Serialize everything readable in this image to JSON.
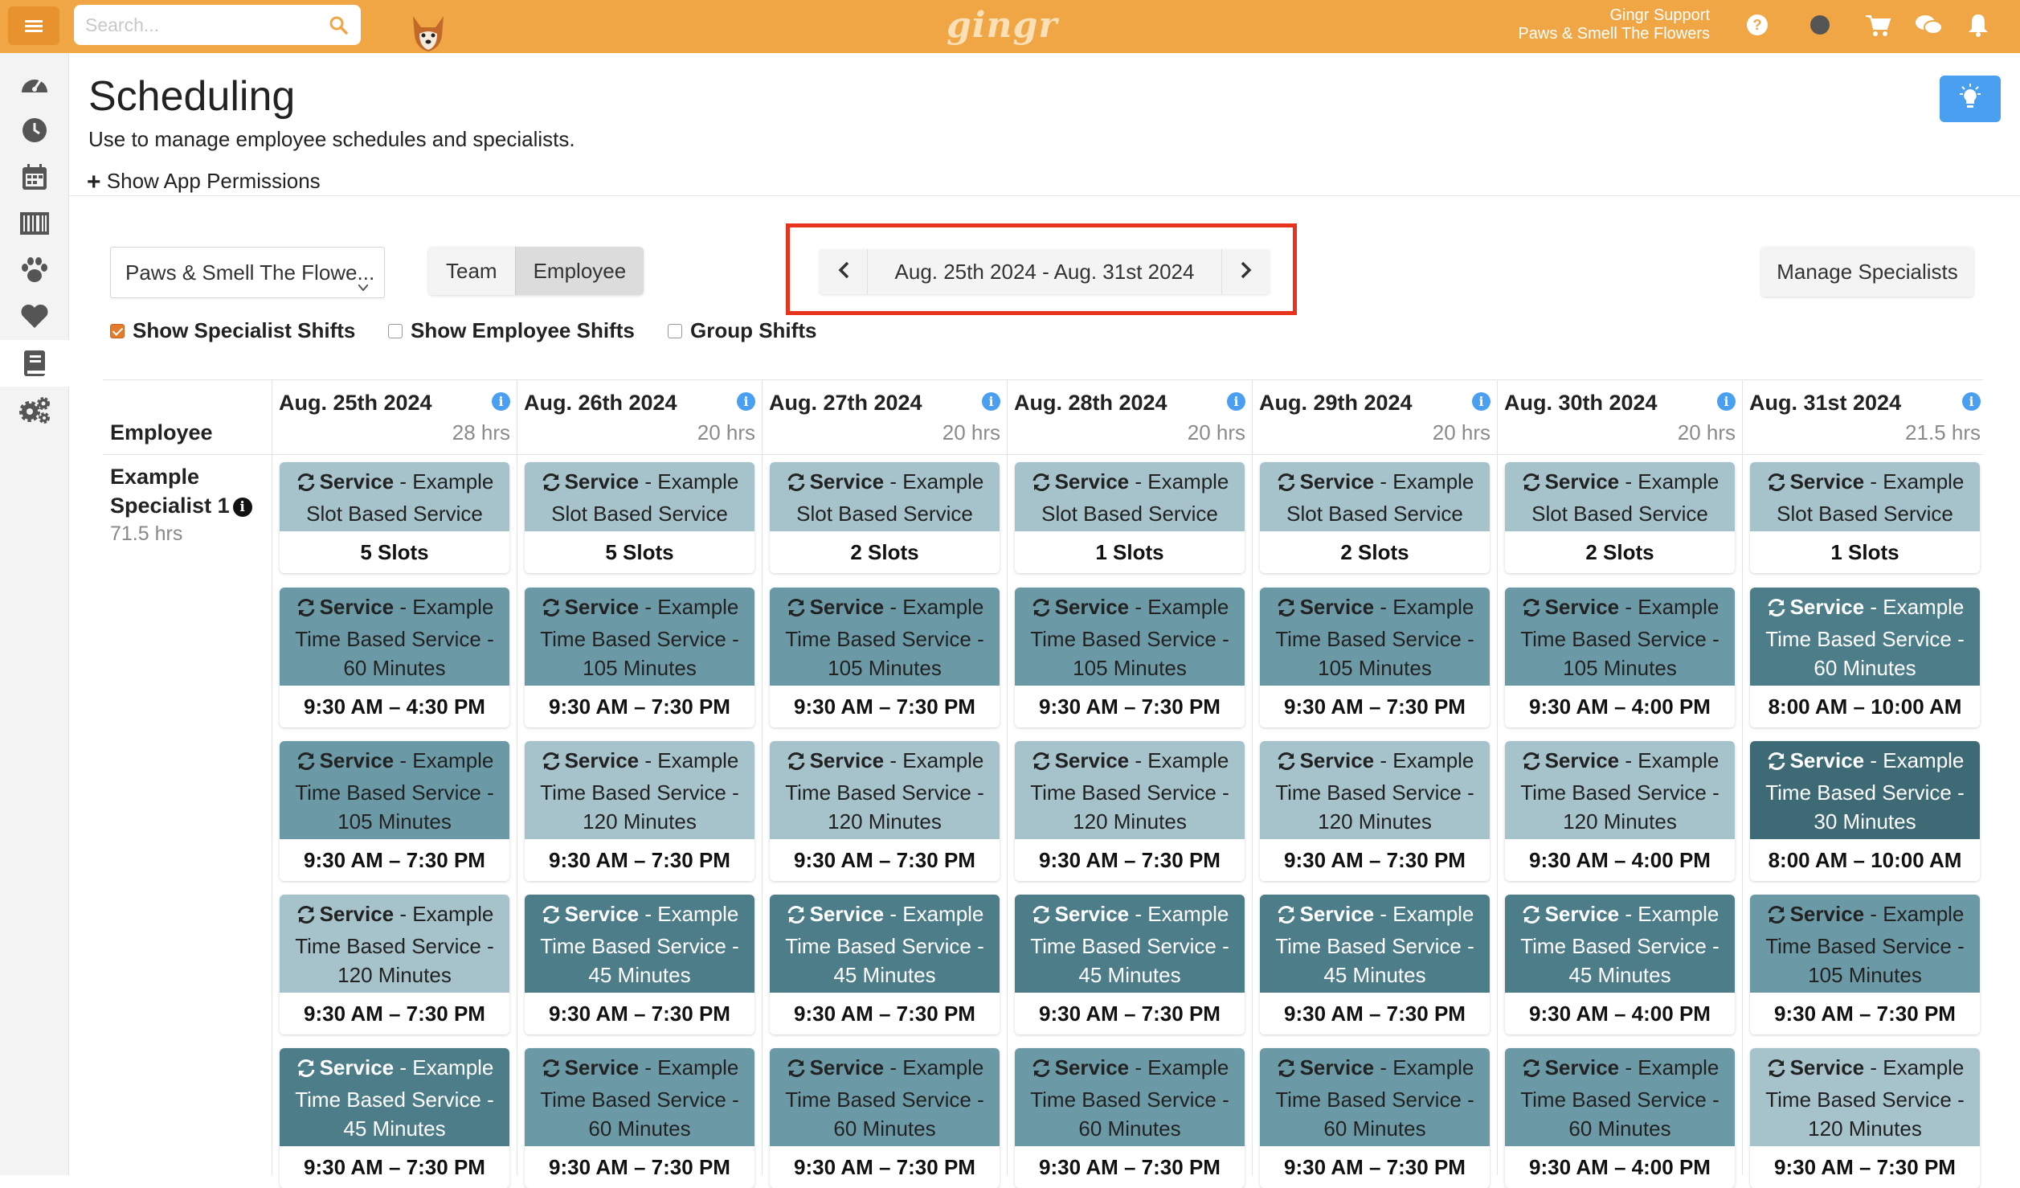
{
  "topbar": {
    "search_placeholder": "Search...",
    "logo": "gingr",
    "user_name": "Gingr Support",
    "user_location": "Paws & Smell The Flowers",
    "icons": [
      "menu-icon",
      "search-icon",
      "dog-avatar-icon",
      "help-icon",
      "status-dot-icon",
      "cart-icon",
      "chat-icon",
      "bell-icon"
    ]
  },
  "sidebar": {
    "items": [
      {
        "name": "dashboard-icon"
      },
      {
        "name": "clock-icon"
      },
      {
        "name": "calendar-icon"
      },
      {
        "name": "barcode-icon"
      },
      {
        "name": "paw-icon"
      },
      {
        "name": "heart-icon"
      },
      {
        "name": "book-icon",
        "active": true
      },
      {
        "name": "settings-icon"
      }
    ]
  },
  "page": {
    "title": "Scheduling",
    "subtitle": "Use to manage employee schedules and specialists.",
    "permissions_link": "Show App Permissions"
  },
  "controls": {
    "location": "Paws & Smell The Flowe...",
    "toggle": [
      "Team",
      "Employee"
    ],
    "toggle_selected": "Employee",
    "date_range": "Aug. 25th 2024 - Aug. 31st 2024",
    "manage_button": "Manage Specialists",
    "checkboxes": [
      {
        "label": "Show Specialist Shifts",
        "checked": true
      },
      {
        "label": "Show Employee Shifts",
        "checked": false
      },
      {
        "label": "Group Shifts",
        "checked": false
      }
    ]
  },
  "colors": {
    "accent": "#f0a644",
    "highlight_box": "#e8331f",
    "info": "#4a9ff0"
  },
  "grid": {
    "employee_header": "Employee",
    "employee": {
      "name": "Example Specialist 1",
      "hours": "71.5 hrs"
    },
    "days": [
      {
        "date": "Aug. 25th 2024",
        "hours": "28 hrs"
      },
      {
        "date": "Aug. 26th 2024",
        "hours": "20 hrs"
      },
      {
        "date": "Aug. 27th 2024",
        "hours": "20 hrs"
      },
      {
        "date": "Aug. 28th 2024",
        "hours": "20 hrs"
      },
      {
        "date": "Aug. 29th 2024",
        "hours": "20 hrs"
      },
      {
        "date": "Aug. 30th 2024",
        "hours": "20 hrs"
      },
      {
        "date": "Aug. 31st 2024",
        "hours": "21.5 hrs"
      }
    ],
    "service_word": "Service",
    "cards": [
      [
        {
          "desc": "Slot Based Service",
          "detail": "5 Slots",
          "shade": "c1"
        },
        {
          "desc": "Time Based Service - 60 Minutes",
          "detail": "9:30 AM – 4:30 PM",
          "shade": "c2"
        },
        {
          "desc": "Time Based Service - 105 Minutes",
          "detail": "9:30 AM – 7:30 PM",
          "shade": "c2"
        },
        {
          "desc": "Time Based Service - 120 Minutes",
          "detail": "9:30 AM – 7:30 PM",
          "shade": "c1"
        },
        {
          "desc": "Time Based Service - 45 Minutes",
          "detail": "9:30 AM – 7:30 PM",
          "shade": "c3"
        }
      ],
      [
        {
          "desc": "Slot Based Service",
          "detail": "5 Slots",
          "shade": "c1"
        },
        {
          "desc": "Time Based Service - 105 Minutes",
          "detail": "9:30 AM – 7:30 PM",
          "shade": "c2"
        },
        {
          "desc": "Time Based Service - 120 Minutes",
          "detail": "9:30 AM – 7:30 PM",
          "shade": "c1"
        },
        {
          "desc": "Time Based Service - 45 Minutes",
          "detail": "9:30 AM – 7:30 PM",
          "shade": "c3"
        },
        {
          "desc": "Time Based Service - 60 Minutes",
          "detail": "9:30 AM – 7:30 PM",
          "shade": "c2"
        }
      ],
      [
        {
          "desc": "Slot Based Service",
          "detail": "2 Slots",
          "shade": "c1"
        },
        {
          "desc": "Time Based Service - 105 Minutes",
          "detail": "9:30 AM – 7:30 PM",
          "shade": "c2"
        },
        {
          "desc": "Time Based Service - 120 Minutes",
          "detail": "9:30 AM – 7:30 PM",
          "shade": "c1"
        },
        {
          "desc": "Time Based Service - 45 Minutes",
          "detail": "9:30 AM – 7:30 PM",
          "shade": "c3"
        },
        {
          "desc": "Time Based Service - 60 Minutes",
          "detail": "9:30 AM – 7:30 PM",
          "shade": "c2"
        }
      ],
      [
        {
          "desc": "Slot Based Service",
          "detail": "1 Slots",
          "shade": "c1"
        },
        {
          "desc": "Time Based Service - 105 Minutes",
          "detail": "9:30 AM – 7:30 PM",
          "shade": "c2"
        },
        {
          "desc": "Time Based Service - 120 Minutes",
          "detail": "9:30 AM – 7:30 PM",
          "shade": "c1"
        },
        {
          "desc": "Time Based Service - 45 Minutes",
          "detail": "9:30 AM – 7:30 PM",
          "shade": "c3"
        },
        {
          "desc": "Time Based Service - 60 Minutes",
          "detail": "9:30 AM – 7:30 PM",
          "shade": "c2"
        }
      ],
      [
        {
          "desc": "Slot Based Service",
          "detail": "2 Slots",
          "shade": "c1"
        },
        {
          "desc": "Time Based Service - 105 Minutes",
          "detail": "9:30 AM – 7:30 PM",
          "shade": "c2"
        },
        {
          "desc": "Time Based Service - 120 Minutes",
          "detail": "9:30 AM – 7:30 PM",
          "shade": "c1"
        },
        {
          "desc": "Time Based Service - 45 Minutes",
          "detail": "9:30 AM – 7:30 PM",
          "shade": "c3"
        },
        {
          "desc": "Time Based Service - 60 Minutes",
          "detail": "9:30 AM – 7:30 PM",
          "shade": "c2"
        }
      ],
      [
        {
          "desc": "Slot Based Service",
          "detail": "2 Slots",
          "shade": "c1"
        },
        {
          "desc": "Time Based Service - 105 Minutes",
          "detail": "9:30 AM – 4:00 PM",
          "shade": "c2"
        },
        {
          "desc": "Time Based Service - 120 Minutes",
          "detail": "9:30 AM – 4:00 PM",
          "shade": "c1"
        },
        {
          "desc": "Time Based Service - 45 Minutes",
          "detail": "9:30 AM – 4:00 PM",
          "shade": "c3"
        },
        {
          "desc": "Time Based Service - 60 Minutes",
          "detail": "9:30 AM – 4:00 PM",
          "shade": "c2"
        }
      ],
      [
        {
          "desc": "Slot Based Service",
          "detail": "1 Slots",
          "shade": "c1"
        },
        {
          "desc": "Time Based Service - 60 Minutes",
          "detail": "8:00 AM – 10:00 AM",
          "shade": "c3"
        },
        {
          "desc": "Time Based Service - 30 Minutes",
          "detail": "8:00 AM – 10:00 AM",
          "shade": "c4"
        },
        {
          "desc": "Time Based Service - 105 Minutes",
          "detail": "9:30 AM – 7:30 PM",
          "shade": "c2"
        },
        {
          "desc": "Time Based Service - 120 Minutes",
          "detail": "9:30 AM – 7:30 PM",
          "shade": "c1"
        }
      ]
    ]
  }
}
